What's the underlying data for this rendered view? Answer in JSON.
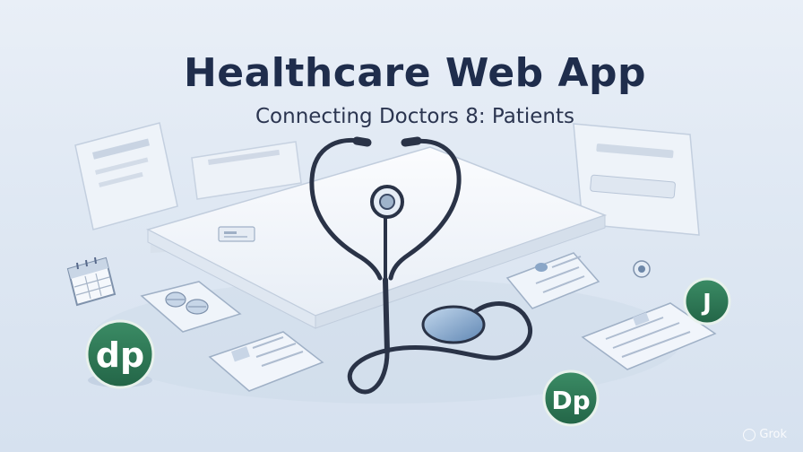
{
  "header": {
    "title": "Healthcare Web App",
    "subtitle": "Connecting Doctors 8: Patients"
  },
  "badges": {
    "left_logo": "dp",
    "bottom_logo": "Dp",
    "right_logo": "J"
  },
  "watermark": {
    "text": "Grok"
  },
  "colors": {
    "title": "#1f2d4c",
    "badge_green": "#2f7d5a",
    "stethoscope": "#2a3347",
    "card_fill": "#f4f7fb"
  }
}
